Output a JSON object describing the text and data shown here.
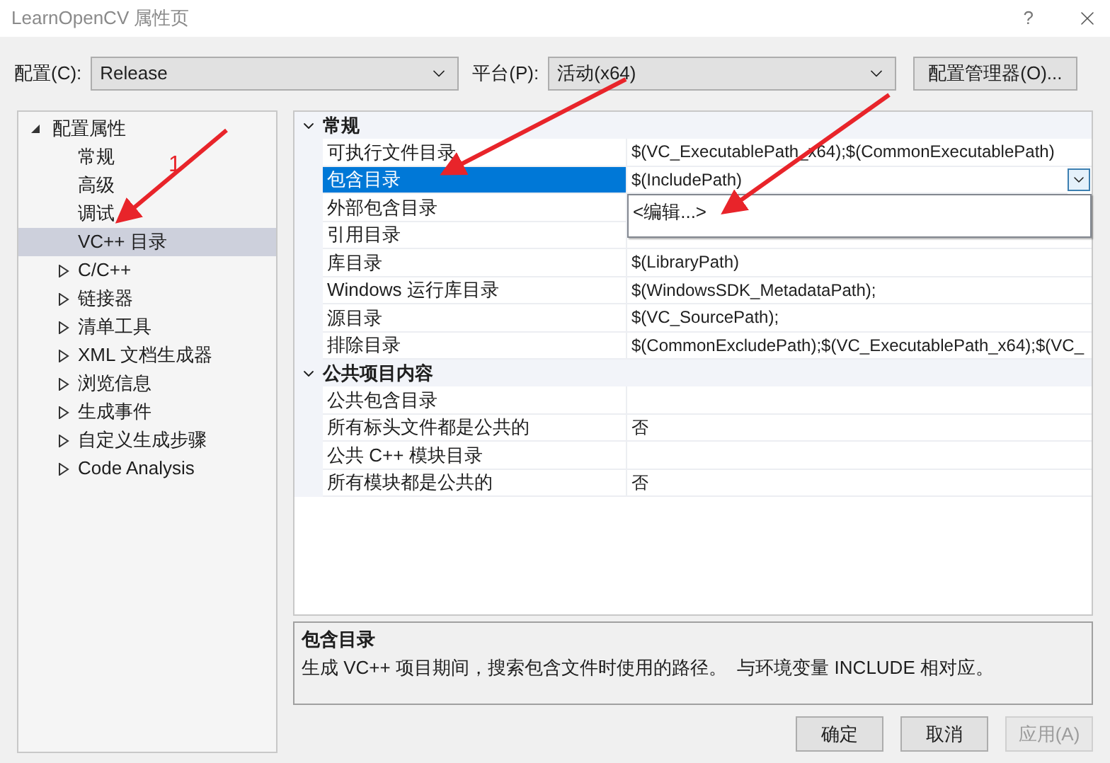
{
  "window": {
    "title": "LearnOpenCV 属性页",
    "help": "?"
  },
  "config": {
    "label": "配置(C):",
    "value": "Release"
  },
  "platform": {
    "label": "平台(P):",
    "value": "活动(x64)"
  },
  "manager_button": "配置管理器(O)...",
  "tree": {
    "label": "配置属性",
    "expanded": true,
    "children": [
      {
        "label": "常规",
        "selected": false
      },
      {
        "label": "高级",
        "selected": false
      },
      {
        "label": "调试",
        "selected": false
      },
      {
        "label": "VC++ 目录",
        "selected": true
      },
      {
        "label": "C/C++",
        "selected": false,
        "expanded": false
      },
      {
        "label": "链接器",
        "selected": false,
        "expanded": false
      },
      {
        "label": "清单工具",
        "selected": false,
        "expanded": false
      },
      {
        "label": "XML 文档生成器",
        "selected": false,
        "expanded": false
      },
      {
        "label": "浏览信息",
        "selected": false,
        "expanded": false
      },
      {
        "label": "生成事件",
        "selected": false,
        "expanded": false
      },
      {
        "label": "自定义生成步骤",
        "selected": false,
        "expanded": false
      },
      {
        "label": "Code Analysis",
        "selected": false,
        "expanded": false
      }
    ]
  },
  "sections": [
    {
      "title": "常规",
      "expanded": true,
      "rows": [
        {
          "name": "可执行文件目录",
          "value": "$(VC_ExecutablePath_x64);$(CommonExecutablePath)",
          "selected": false
        },
        {
          "name": "包含目录",
          "value": "$(IncludePath)",
          "selected": true,
          "dropdown_open": true,
          "dropdown_items": [
            "<编辑...>"
          ]
        },
        {
          "name": "外部包含目录",
          "selected": false
        },
        {
          "name": "引用目录",
          "selected": false
        },
        {
          "name": "库目录",
          "value": "$(LibraryPath)",
          "selected": false
        },
        {
          "name": "Windows 运行库目录",
          "value": "$(WindowsSDK_MetadataPath);",
          "selected": false
        },
        {
          "name": "源目录",
          "value": "$(VC_SourcePath);",
          "selected": false
        },
        {
          "name": "排除目录",
          "value": "$(CommonExcludePath);$(VC_ExecutablePath_x64);$(VC_",
          "selected": false
        }
      ]
    },
    {
      "title": "公共项目内容",
      "expanded": true,
      "rows": [
        {
          "name": "公共包含目录",
          "selected": false
        },
        {
          "name": "所有标头文件都是公共的",
          "value": "否",
          "selected": false
        },
        {
          "name": "公共 C++ 模块目录",
          "selected": false
        },
        {
          "name": "所有模块都是公共的",
          "value": "否",
          "selected": false
        }
      ]
    }
  ],
  "description": {
    "title": "包含目录",
    "text": "生成 VC++ 项目期间，搜索包含文件时使用的路径。  与环境变量 INCLUDE 相对应。"
  },
  "buttons": [
    {
      "label": "确定",
      "disabled": false
    },
    {
      "label": "取消",
      "disabled": false
    },
    {
      "label": "应用(A)",
      "disabled": true
    }
  ],
  "annotation": {
    "marker": "1"
  }
}
